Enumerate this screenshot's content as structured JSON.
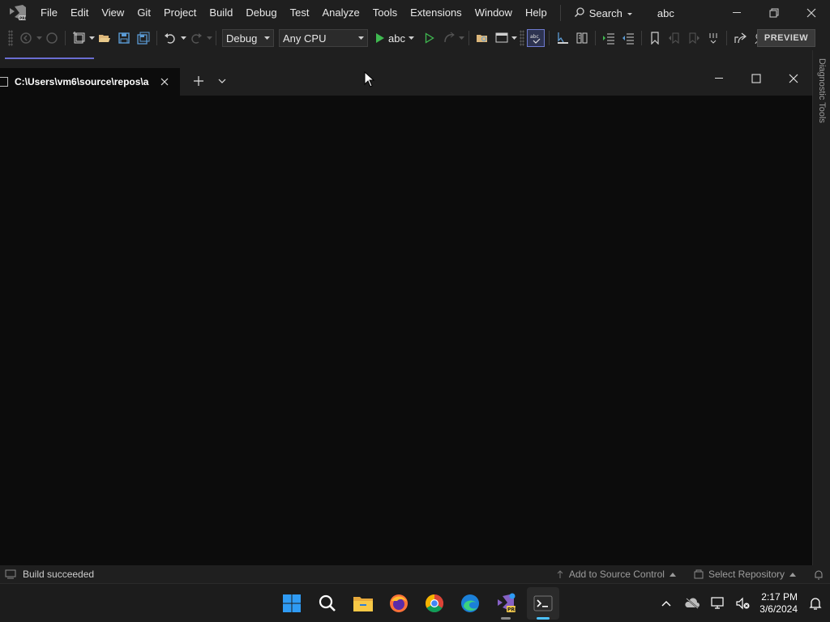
{
  "vs": {
    "menu": [
      "File",
      "Edit",
      "View",
      "Git",
      "Project",
      "Build",
      "Debug",
      "Test",
      "Analyze",
      "Tools",
      "Extensions",
      "Window",
      "Help"
    ],
    "search_label": "Search",
    "solution_name": "abc",
    "toolbar": {
      "configuration": "Debug",
      "platform": "Any CPU",
      "run_target": "abc",
      "preview_label": "PREVIEW"
    },
    "right_rail_label": "Diagnostic Tools",
    "status": {
      "left": "Build succeeded",
      "source_control": "Add to Source Control",
      "repository": "Select Repository"
    }
  },
  "terminal": {
    "tab_title": "C:\\Users\\vm6\\source\\repos\\a"
  },
  "taskbar": {
    "apps": [
      "start-icon",
      "search-icon",
      "file-explorer-icon",
      "firefox-icon",
      "chrome-icon",
      "edge-icon",
      "visual-studio-preview-icon",
      "terminal-icon"
    ],
    "time": "2:17 PM",
    "date": "3/6/2024"
  },
  "colors": {
    "vs_chrome": "#1f1f1f",
    "terminal_bg": "#0c0c0c",
    "accent": "#6a6dd1",
    "taskbar_indicator": "#4cc2ff"
  }
}
